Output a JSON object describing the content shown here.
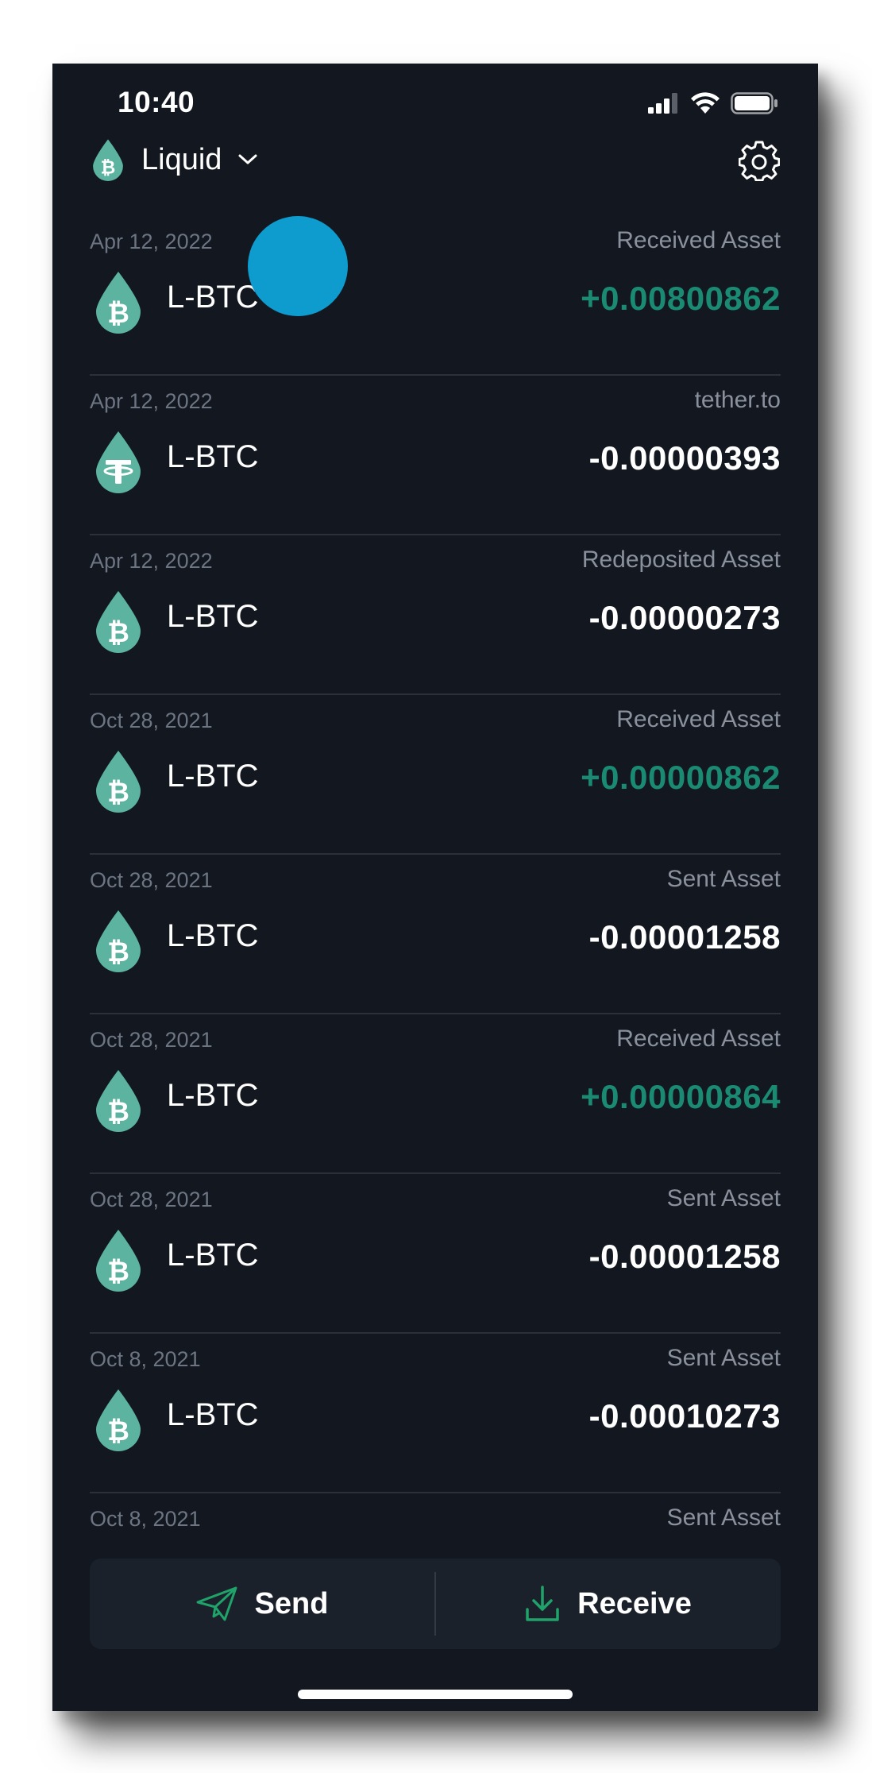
{
  "status_bar": {
    "time": "10:40",
    "icons": [
      "cellular-signal-icon",
      "wifi-icon",
      "battery-icon"
    ]
  },
  "header": {
    "wallet_name": "Liquid",
    "wallet_icon": "liquid-bitcoin-drop-icon",
    "dropdown_icon": "chevron-down-icon",
    "settings_icon": "gear-icon"
  },
  "colors": {
    "background": "#121720",
    "accent_green": "#1a8a73",
    "icon_teal": "#5bb3a0",
    "touch_indicator": "#0e9ccf"
  },
  "transactions": [
    {
      "date": "Apr 12, 2022",
      "type": "Received Asset",
      "asset": "L-BTC",
      "amount": "+0.00800862",
      "icon": "liquid-bitcoin-drop-icon"
    },
    {
      "date": "Apr 12, 2022",
      "type": "tether.to",
      "asset": "L-BTC",
      "amount": "-0.00000393",
      "icon": "tether-drop-icon"
    },
    {
      "date": "Apr 12, 2022",
      "type": "Redeposited Asset",
      "asset": "L-BTC",
      "amount": "-0.00000273",
      "icon": "liquid-bitcoin-drop-icon"
    },
    {
      "date": "Oct 28, 2021",
      "type": "Received Asset",
      "asset": "L-BTC",
      "amount": "+0.00000862",
      "icon": "liquid-bitcoin-drop-icon"
    },
    {
      "date": "Oct 28, 2021",
      "type": "Sent Asset",
      "asset": "L-BTC",
      "amount": "-0.00001258",
      "icon": "liquid-bitcoin-drop-icon"
    },
    {
      "date": "Oct 28, 2021",
      "type": "Received Asset",
      "asset": "L-BTC",
      "amount": "+0.00000864",
      "icon": "liquid-bitcoin-drop-icon"
    },
    {
      "date": "Oct 28, 2021",
      "type": "Sent Asset",
      "asset": "L-BTC",
      "amount": "-0.00001258",
      "icon": "liquid-bitcoin-drop-icon"
    },
    {
      "date": "Oct 8, 2021",
      "type": "Sent Asset",
      "asset": "L-BTC",
      "amount": "-0.00010273",
      "icon": "liquid-bitcoin-drop-icon"
    },
    {
      "date": "Oct 8, 2021",
      "type": "Sent Asset"
    }
  ],
  "actions": {
    "send_label": "Send",
    "send_icon": "paper-plane-icon",
    "receive_label": "Receive",
    "receive_icon": "download-icon"
  }
}
